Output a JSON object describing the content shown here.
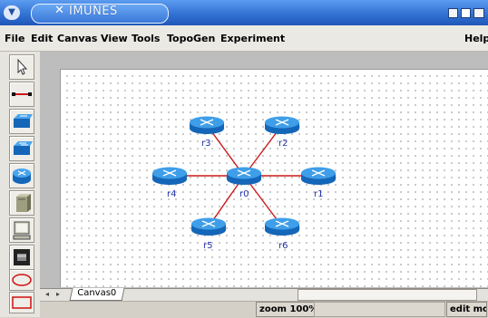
{
  "window": {
    "title": "IMUNES",
    "close_glyph": "✕",
    "sysmenu_glyph": "▼"
  },
  "menu": {
    "items": [
      "File",
      "Edit",
      "Canvas",
      "View",
      "Tools",
      "TopoGen",
      "Experiment"
    ],
    "help": "Help"
  },
  "toolbar": {
    "tools": [
      {
        "name": "select-tool",
        "icon": "cursor-arrow-icon"
      },
      {
        "name": "link-tool",
        "icon": "link-line-icon"
      },
      {
        "name": "hub-tool",
        "icon": "hub-icon"
      },
      {
        "name": "switch-tool",
        "icon": "switch-icon"
      },
      {
        "name": "router-tool",
        "icon": "router-icon"
      },
      {
        "name": "host-tool",
        "icon": "host-server-icon"
      },
      {
        "name": "pc-tool",
        "icon": "pc-monitor-icon"
      },
      {
        "name": "external-interface-tool",
        "icon": "rj45-port-icon"
      },
      {
        "name": "oval-tool",
        "icon": "red-oval-icon"
      },
      {
        "name": "rectangle-tool",
        "icon": "red-rectangle-icon"
      }
    ]
  },
  "topology": {
    "hub": "r0",
    "routers": [
      {
        "id": "r0",
        "label": "r0"
      },
      {
        "id": "r1",
        "label": "r1"
      },
      {
        "id": "r2",
        "label": "r2"
      },
      {
        "id": "r3",
        "label": "r3"
      },
      {
        "id": "r4",
        "label": "r4"
      },
      {
        "id": "r5",
        "label": "r5"
      },
      {
        "id": "r6",
        "label": "r6"
      }
    ],
    "links": [
      [
        "r0",
        "r1"
      ],
      [
        "r0",
        "r2"
      ],
      [
        "r0",
        "r3"
      ],
      [
        "r0",
        "r4"
      ],
      [
        "r0",
        "r5"
      ],
      [
        "r0",
        "r6"
      ]
    ],
    "link_color": "#cc1818"
  },
  "tabs": {
    "canvas_tab": "Canvas0"
  },
  "status": {
    "zoom": "zoom 100%",
    "mode": "edit mode"
  },
  "colors": {
    "router_top": "#3f9ee8",
    "router_body": "#1466b8",
    "label": "#2230a8"
  }
}
